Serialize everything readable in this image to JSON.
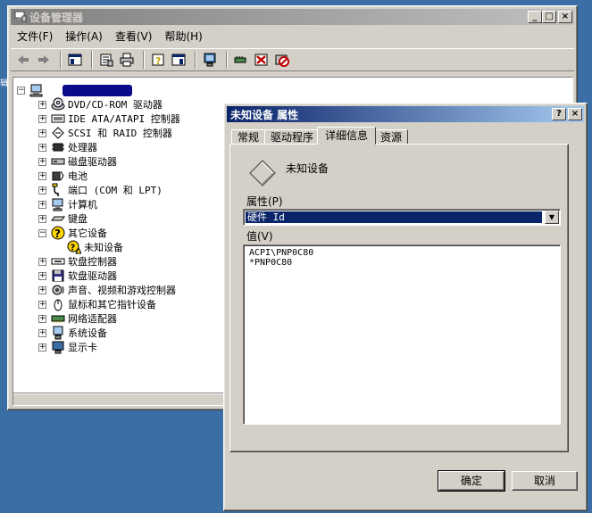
{
  "device_manager": {
    "title": "设备管理器",
    "menu": [
      "文件(F)",
      "操作(A)",
      "查看(V)",
      "帮助(H)"
    ],
    "tree": [
      {
        "label": "DVD/CD-ROM 驱动器",
        "icon": "cdrom-icon",
        "mono": true
      },
      {
        "label": "IDE ATA/ATAPI 控制器",
        "icon": "ide-controller-icon",
        "mono": true
      },
      {
        "label": "SCSI 和 RAID 控制器",
        "icon": "scsi-controller-icon",
        "mono": true
      },
      {
        "label": "处理器",
        "icon": "processor-icon"
      },
      {
        "label": "磁盘驱动器",
        "icon": "disk-drive-icon"
      },
      {
        "label": "电池",
        "icon": "battery-icon"
      },
      {
        "label": "端口 (COM 和 LPT)",
        "icon": "port-icon",
        "mono": true
      },
      {
        "label": "计算机",
        "icon": "computer-icon"
      },
      {
        "label": "键盘",
        "icon": "keyboard-icon"
      },
      {
        "label": "其它设备",
        "icon": "unknown-device-icon",
        "expanded": true
      },
      {
        "label": "未知设备",
        "icon": "warning-device-icon",
        "child": true
      },
      {
        "label": "软盘控制器",
        "icon": "floppy-controller-icon"
      },
      {
        "label": "软盘驱动器",
        "icon": "floppy-drive-icon"
      },
      {
        "label": "声音、视频和游戏控制器",
        "icon": "sound-icon"
      },
      {
        "label": "鼠标和其它指针设备",
        "icon": "mouse-icon"
      },
      {
        "label": "网络适配器",
        "icon": "network-adapter-icon"
      },
      {
        "label": "系统设备",
        "icon": "system-device-icon"
      },
      {
        "label": "显示卡",
        "icon": "display-adapter-icon"
      }
    ]
  },
  "dialog": {
    "title": "未知设备 属性",
    "tabs": [
      "常规",
      "驱动程序",
      "详细信息",
      "资源"
    ],
    "selected_tab": 2,
    "device_name": "未知设备",
    "property_label": "属性(P)",
    "property_value": "硬件 Id",
    "values_label": "值(V)",
    "values": [
      "ACPI\\PNP0C80",
      "*PNP0C80"
    ],
    "ok_label": "确定",
    "cancel_label": "取消"
  },
  "colors": {
    "desktop": "#3a6ea5",
    "active_title": "#0a246a",
    "inactive_title": "#808080",
    "face": "#d4d0c8"
  }
}
